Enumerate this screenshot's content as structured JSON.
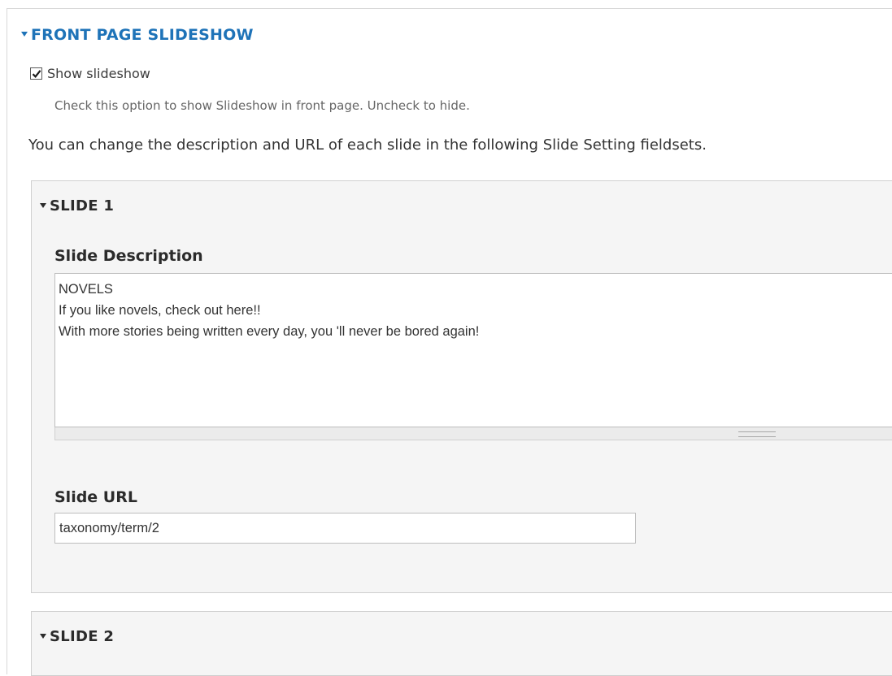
{
  "fieldset": {
    "title": "FRONT PAGE SLIDESHOW"
  },
  "show_slideshow": {
    "label": "Show slideshow",
    "checked": true,
    "help": "Check this option to show Slideshow in front page. Uncheck to hide."
  },
  "info_text": "You can change the description and URL of each slide in the following Slide Setting fieldsets.",
  "slides": [
    {
      "title": "SLIDE 1",
      "description_label": "Slide Description",
      "description_value": "NOVELS\nIf you like novels, check out here!!\nWith more stories being written every day, you 'll never be bored again!",
      "url_label": "Slide URL",
      "url_value": "taxonomy/term/2"
    },
    {
      "title": "SLIDE 2"
    }
  ],
  "colors": {
    "legend_blue": "#1e73b8",
    "panel_bg": "#f5f5f5"
  }
}
